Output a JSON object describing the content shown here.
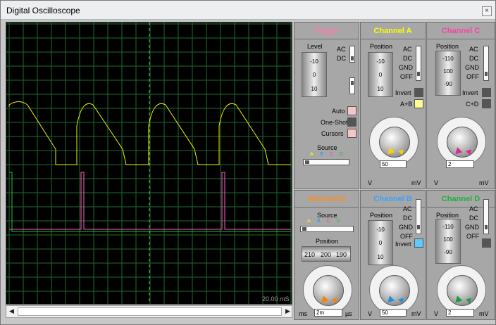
{
  "window": {
    "title": "Digital Oscilloscope",
    "close_glyph": "×"
  },
  "scope": {
    "timebase": "20.00 mS",
    "grid_color": "#1e6b2e",
    "trace_colors": {
      "a": "#f0f000",
      "b": "#ff5fc8",
      "c": "#22c040"
    }
  },
  "scrollbar": {
    "left": "◀",
    "right": "▶"
  },
  "trigger": {
    "title": "Trigger",
    "title_color": "#ff7ab0",
    "level": "Level",
    "ac": "AC",
    "dc": "DC",
    "drum": [
      "-10",
      "0",
      "10"
    ],
    "auto": "Auto",
    "oneshot": "One-Shot",
    "cursors": "Cursors",
    "source": "Source",
    "src": [
      "A",
      "B",
      "C",
      "D"
    ]
  },
  "channel_a": {
    "title": "Channel A",
    "title_color": "#ffff00",
    "position": "Position",
    "drum": [
      "-10",
      "0",
      "10"
    ],
    "ac": "AC",
    "dc": "DC",
    "gnd": "GND",
    "off": "OFF",
    "invert": "Invert",
    "combine": "A+B",
    "volts": "50",
    "v": "V",
    "mv": "mV",
    "scale": [
      "0.5",
      "0.2",
      "0.1",
      "50",
      "20",
      "10",
      "5",
      "2",
      "1",
      "5",
      "2",
      "10",
      "20"
    ]
  },
  "channel_c": {
    "title": "Channel C",
    "title_color": "#ff3faa",
    "position": "Position",
    "drum": [
      "-110",
      "100",
      "-90",
      "-80"
    ],
    "ac": "AC",
    "dc": "DC",
    "gnd": "GND",
    "off": "OFF",
    "invert": "Invert",
    "combine": "C+D",
    "volts": "2",
    "v": "V",
    "mv": "mV",
    "scale": [
      "0.5",
      "0.2",
      "0.1",
      "50",
      "20",
      "10",
      "5",
      "2",
      "1",
      "5",
      "2",
      "10",
      "20"
    ]
  },
  "horizontal": {
    "title": "Horizontal",
    "title_color": "#ff8c1a",
    "source": "Source",
    "src": [
      "A",
      "B",
      "C",
      "D"
    ],
    "position": "Position",
    "drum": [
      "210",
      "200",
      "190"
    ],
    "value": "2m",
    "ms": "ms",
    "us": "µs",
    "scale": [
      "1",
      "0.5",
      "0.2",
      "0.1",
      "50",
      "20",
      "10",
      "5",
      "2",
      "1",
      "0.5",
      "2",
      "5",
      "10",
      "20",
      "50",
      "100",
      "200"
    ]
  },
  "channel_b": {
    "title": "Channel B",
    "title_color": "#3aa0ff",
    "position": "Position",
    "drum": [
      "-10",
      "0",
      "10"
    ],
    "ac": "AC",
    "dc": "DC",
    "gnd": "GND",
    "off": "OFF",
    "invert": "Invert",
    "volts": "50",
    "v": "V",
    "mv": "mV",
    "scale": [
      "0.5",
      "0.2",
      "0.1",
      "50",
      "20",
      "10",
      "5",
      "2",
      "1",
      "5",
      "2",
      "10",
      "20"
    ]
  },
  "channel_d": {
    "title": "Channel D",
    "title_color": "#20b040",
    "position": "Position",
    "drum": [
      "-110",
      "100",
      "-90",
      "-80"
    ],
    "ac": "AC",
    "dc": "DC",
    "gnd": "GND",
    "off": "OFF",
    "volts": "2",
    "v": "V",
    "mv": "mV",
    "scale": [
      "0.5",
      "0.2",
      "0.1",
      "50",
      "20",
      "10",
      "5",
      "2",
      "1",
      "5",
      "2",
      "10",
      "20"
    ]
  }
}
